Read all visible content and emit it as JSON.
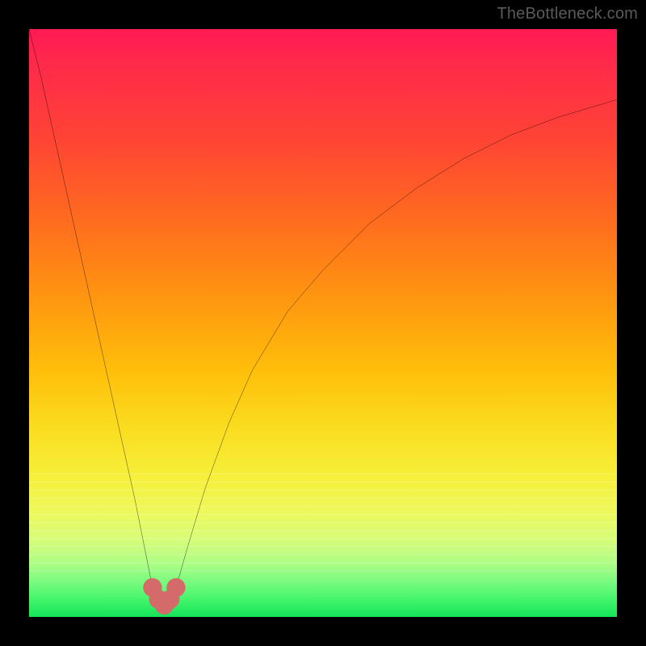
{
  "attribution": "TheBottleneck.com",
  "chart_data": {
    "type": "line",
    "title": "",
    "xlabel": "",
    "ylabel": "",
    "xlim": [
      0,
      100
    ],
    "ylim": [
      0,
      100
    ],
    "grid": false,
    "legend": false,
    "background_gradient_stops": [
      {
        "pos": 0,
        "color": "#ff1a55"
      },
      {
        "pos": 18,
        "color": "#ff4236"
      },
      {
        "pos": 46,
        "color": "#ff9710"
      },
      {
        "pos": 68,
        "color": "#fadd20"
      },
      {
        "pos": 82,
        "color": "#eef85a"
      },
      {
        "pos": 94,
        "color": "#7afb7f"
      },
      {
        "pos": 100,
        "color": "#14e45a"
      }
    ],
    "series": [
      {
        "name": "bottleneck-curve",
        "color": "#000000",
        "x": [
          0,
          2,
          4,
          6,
          8,
          10,
          12,
          14,
          16,
          18,
          20,
          21,
          22,
          23,
          24,
          25,
          27,
          30,
          34,
          38,
          44,
          50,
          58,
          66,
          74,
          82,
          90,
          100
        ],
        "y": [
          100,
          92,
          83,
          74,
          65,
          56,
          47,
          38,
          29,
          20,
          10,
          5,
          3,
          2,
          3,
          5,
          12,
          22,
          33,
          42,
          52,
          59,
          67,
          73,
          78,
          82,
          85,
          88
        ]
      }
    ],
    "markers": [
      {
        "name": "dip-marker-left",
        "x": 21.0,
        "y": 5,
        "color": "#d46a6a",
        "r": 1.6
      },
      {
        "name": "dip-marker-mid-l",
        "x": 22.0,
        "y": 3,
        "color": "#d46a6a",
        "r": 1.6
      },
      {
        "name": "dip-marker-center",
        "x": 23.0,
        "y": 2,
        "color": "#d46a6a",
        "r": 1.6
      },
      {
        "name": "dip-marker-mid-r",
        "x": 24.0,
        "y": 3,
        "color": "#d46a6a",
        "r": 1.6
      },
      {
        "name": "dip-marker-right",
        "x": 25.0,
        "y": 5,
        "color": "#d46a6a",
        "r": 1.6
      }
    ]
  }
}
